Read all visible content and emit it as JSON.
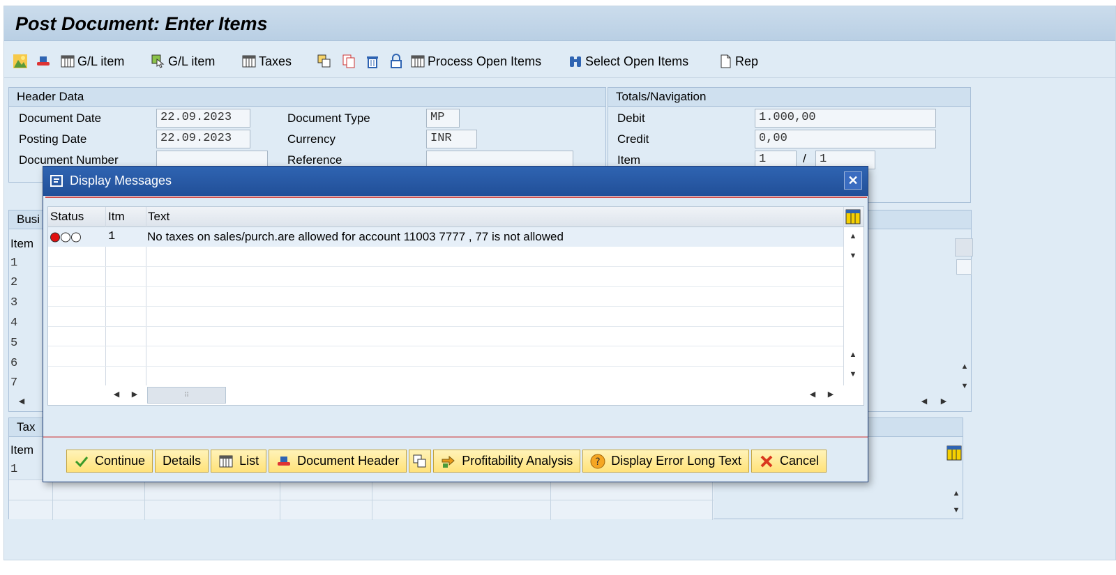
{
  "window": {
    "title": "Post Document: Enter Items"
  },
  "toolbar": {
    "gl_item_1": "G/L item",
    "gl_item_2": "G/L item",
    "taxes": "Taxes",
    "process_open_items": "Process Open Items",
    "select_open_items": "Select Open Items",
    "rep": "Rep"
  },
  "header_data": {
    "title": "Header Data",
    "document_date_label": "Document Date",
    "document_date": "22.09.2023",
    "posting_date_label": "Posting Date",
    "posting_date": "22.09.2023",
    "document_number_label": "Document Number",
    "document_number": "",
    "document_type_label": "Document Type",
    "document_type": "MP",
    "currency_label": "Currency",
    "currency": "INR",
    "reference_label": "Reference",
    "reference": ""
  },
  "totals": {
    "title": "Totals/Navigation",
    "debit_label": "Debit",
    "debit": "1.000,00",
    "credit_label": "Credit",
    "credit": "0,00",
    "item_label": "Item",
    "item_current": "1",
    "item_sep": "/",
    "item_total": "1"
  },
  "business_panel": {
    "title_partial": "Busi",
    "col_item": "Item",
    "rows": [
      "1",
      "2",
      "3",
      "4",
      "5",
      "6",
      "7"
    ]
  },
  "tax_panel": {
    "title_partial": "Tax",
    "col_item": "Item",
    "rows": [
      "1"
    ]
  },
  "dialog": {
    "title": "Display Messages",
    "close": "✕",
    "columns": {
      "status": "Status",
      "itm": "Itm",
      "text": "Text"
    },
    "messages": [
      {
        "status": "error",
        "itm": "1",
        "text": "No taxes on sales/purch.are allowed for account 11003 7777 , 77 is not allowed"
      }
    ],
    "buttons": {
      "continue": "Continue",
      "details": "Details",
      "list": "List",
      "document_header": "Document Header",
      "profitability_analysis": "Profitability Analysis",
      "display_error_long_text": "Display Error Long Text",
      "cancel": "Cancel"
    }
  },
  "colors": {
    "background": "#dfebf5",
    "dialog_title": "#2a5ba8",
    "button_yellow": "#ffe27a",
    "error_red": "#e02020"
  }
}
